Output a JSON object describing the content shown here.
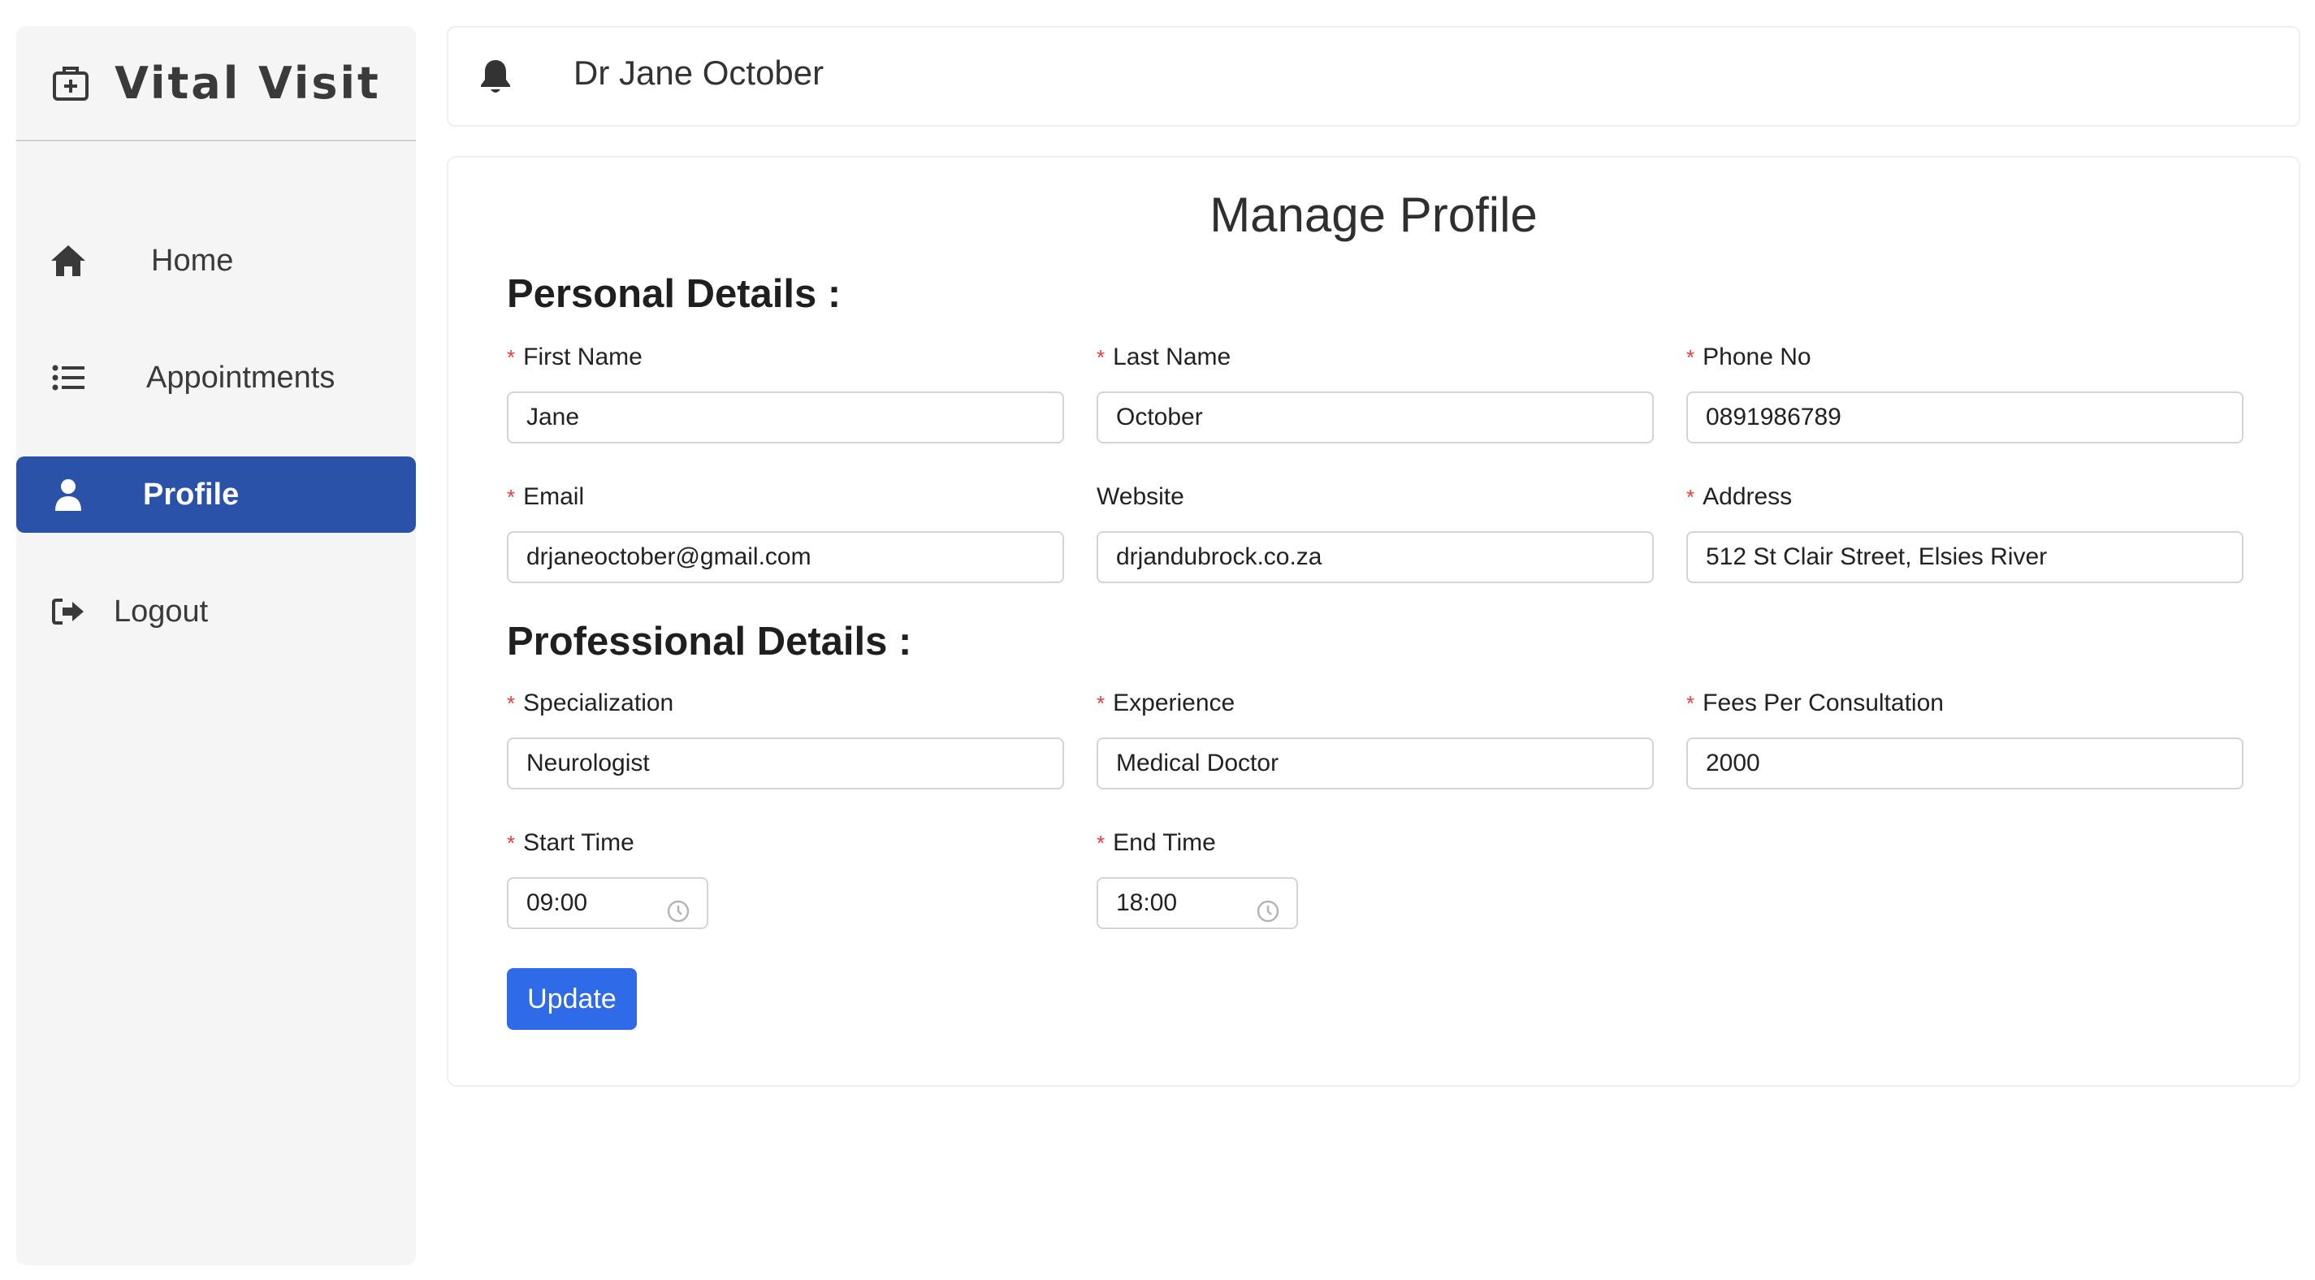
{
  "brand": {
    "name": "Vital Visit",
    "icon": "medical-kit-icon"
  },
  "sidebar": {
    "items": [
      {
        "label": "Home",
        "icon": "home-icon"
      },
      {
        "label": "Appointments",
        "icon": "list-icon"
      },
      {
        "label": "Profile",
        "icon": "user-icon",
        "active": true
      },
      {
        "label": "Logout",
        "icon": "logout-icon"
      }
    ]
  },
  "header": {
    "doctor_name": "Dr Jane October",
    "notification_icon": "bell-icon"
  },
  "main": {
    "title": "Manage Profile",
    "personal": {
      "title": "Personal Details :",
      "first_name": {
        "label": "First Name",
        "value": "Jane",
        "required": true
      },
      "last_name": {
        "label": "Last Name",
        "value": "October",
        "required": true
      },
      "phone": {
        "label": "Phone No",
        "value": "0891986789",
        "required": true
      },
      "email": {
        "label": "Email",
        "value": "drjaneoctober@gmail.com",
        "required": true
      },
      "website": {
        "label": "Website",
        "value": "drjandubrock.co.za",
        "required": false
      },
      "address": {
        "label": "Address",
        "value": "512 St Clair Street, Elsies River",
        "required": true
      }
    },
    "professional": {
      "title": "Professional Details :",
      "specialization": {
        "label": "Specialization",
        "value": "Neurologist",
        "required": true
      },
      "experience": {
        "label": "Experience",
        "value": "Medical Doctor",
        "required": true
      },
      "fees": {
        "label": "Fees Per Consultation",
        "value": "2000",
        "required": true
      },
      "start_time": {
        "label": "Start Time",
        "value": "09:00",
        "required": true
      },
      "end_time": {
        "label": "End Time",
        "value": "18:00",
        "required": true
      }
    },
    "update_label": "Update",
    "required_marker": "*"
  },
  "colors": {
    "sidebar_bg": "#f5f5f5",
    "active_nav": "#2952a8",
    "button": "#2f6be8",
    "required": "#e04040"
  }
}
